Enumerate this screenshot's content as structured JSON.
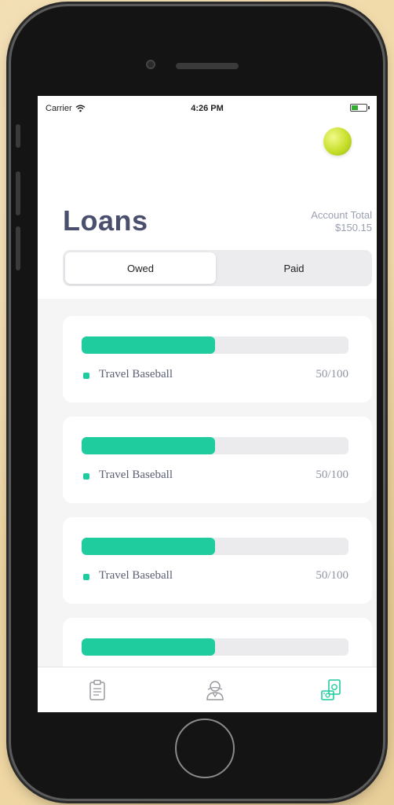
{
  "status_bar": {
    "carrier": "Carrier",
    "time": "4:26 PM",
    "wifi_icon": "wifi-icon",
    "battery_icon": "battery-icon"
  },
  "header": {
    "title": "Loans",
    "account_total_label": "Account Total",
    "account_total_value": "$150.15",
    "avatar": "tennis-ball-avatar"
  },
  "segment": {
    "options": [
      "Owed",
      "Paid"
    ],
    "selected": "Owed"
  },
  "loans": [
    {
      "name": "Travel Baseball",
      "amount_text": "50/100",
      "progress": 0.5
    },
    {
      "name": "Travel Baseball",
      "amount_text": "50/100",
      "progress": 0.5
    },
    {
      "name": "Travel Baseball",
      "amount_text": "50/100",
      "progress": 0.5
    },
    {
      "name": "",
      "amount_text": "",
      "progress": 0.5
    }
  ],
  "tab_bar": {
    "items": [
      {
        "icon": "clipboard-icon",
        "active": false
      },
      {
        "icon": "person-icon",
        "active": false
      },
      {
        "icon": "money-icon",
        "active": true
      }
    ]
  },
  "colors": {
    "accent": "#1fcc9d",
    "title": "#4a4f6e",
    "muted": "#9aa0b1"
  }
}
